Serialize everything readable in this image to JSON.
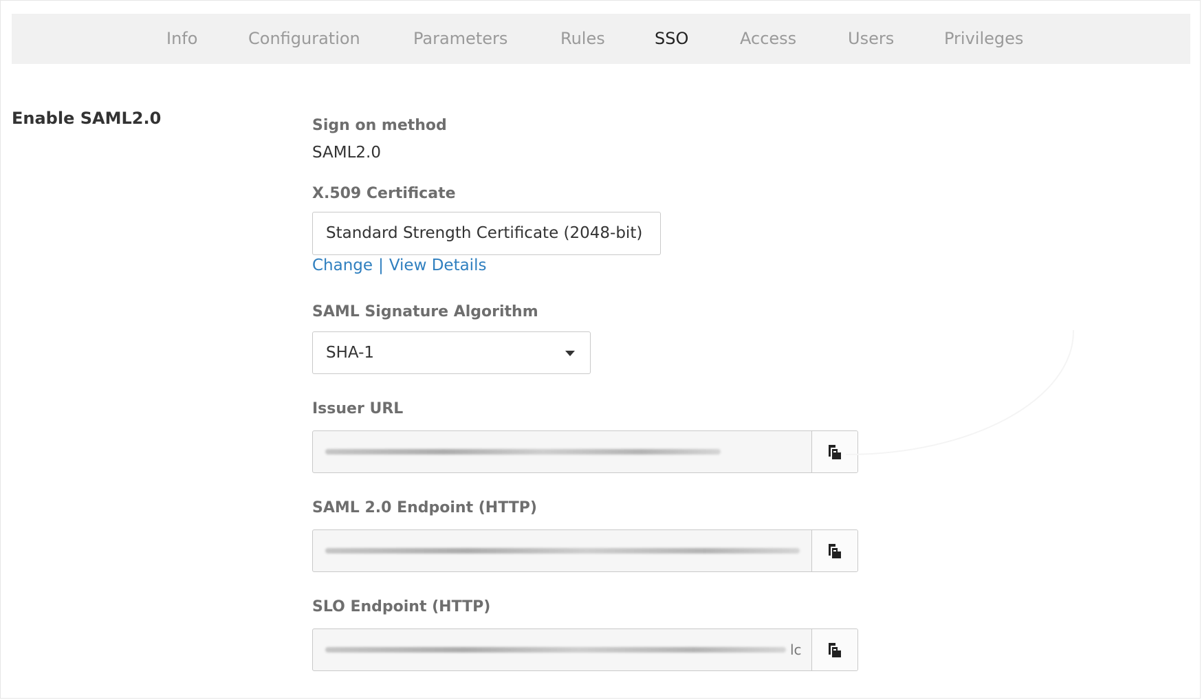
{
  "tabs": [
    {
      "label": "Info"
    },
    {
      "label": "Configuration"
    },
    {
      "label": "Parameters"
    },
    {
      "label": "Rules"
    },
    {
      "label": "SSO"
    },
    {
      "label": "Access"
    },
    {
      "label": "Users"
    },
    {
      "label": "Privileges"
    }
  ],
  "active_tab": "SSO",
  "section": {
    "title": "Enable SAML2.0"
  },
  "sign_on": {
    "label": "Sign on method",
    "value": "SAML2.0"
  },
  "certificate": {
    "label": "X.509 Certificate",
    "value": "Standard Strength Certificate (2048-bit)",
    "change_link": "Change",
    "separator": "|",
    "details_link": "View Details"
  },
  "signature": {
    "label": "SAML Signature Algorithm",
    "selected": "SHA-1"
  },
  "issuer": {
    "label": "Issuer URL"
  },
  "saml_endpoint": {
    "label": "SAML 2.0 Endpoint (HTTP)"
  },
  "slo_endpoint": {
    "label": "SLO Endpoint (HTTP)",
    "visible_tail": "lc"
  },
  "icons": {
    "copy": "copy-icon",
    "dropdown": "caret-down-icon"
  },
  "colors": {
    "link": "#2f7fbf",
    "tabbar_bg": "#f1f1f1",
    "active_tab": "#222222",
    "inactive_tab": "#9a9a9a"
  }
}
